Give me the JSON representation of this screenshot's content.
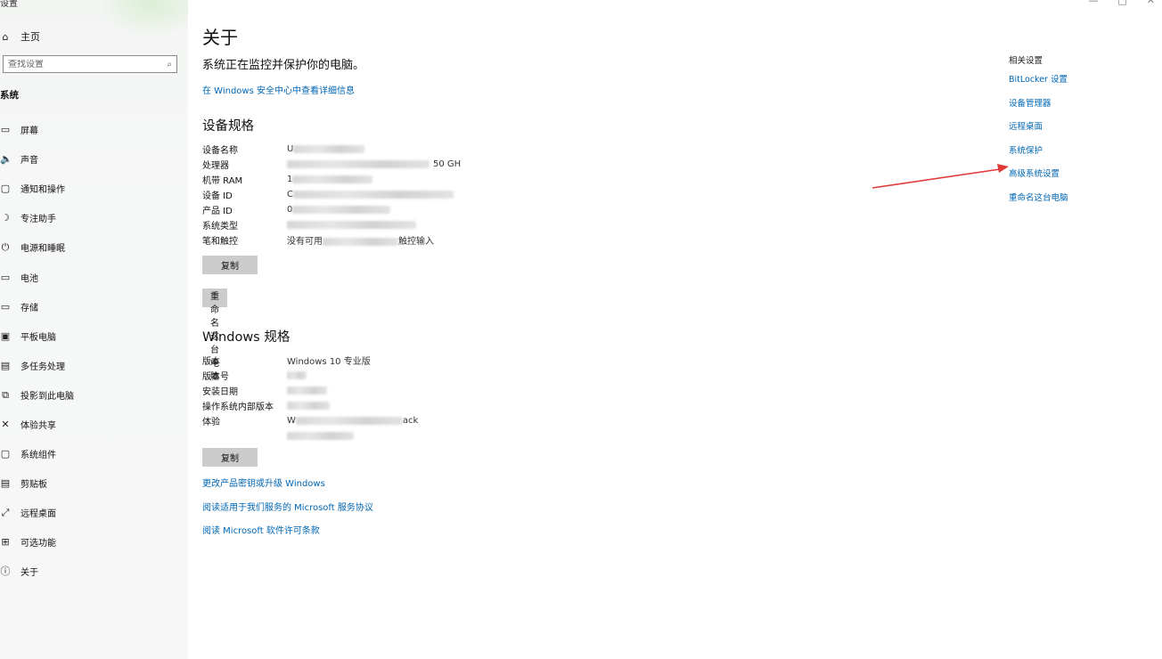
{
  "window": {
    "title": "设置",
    "controls": {
      "minimize": "—",
      "maximize": "□",
      "close": "✕"
    }
  },
  "sidebar": {
    "home_label": "主页",
    "search_placeholder": "查找设置",
    "section_label": "系统",
    "items": [
      {
        "label": "屏幕",
        "icon": "display-icon",
        "glyph": "▭"
      },
      {
        "label": "声音",
        "icon": "speaker-icon",
        "glyph": "🔈"
      },
      {
        "label": "通知和操作",
        "icon": "notification-icon",
        "glyph": "▢"
      },
      {
        "label": "专注助手",
        "icon": "moon-icon",
        "glyph": "☽"
      },
      {
        "label": "电源和睡眠",
        "icon": "power-icon",
        "glyph": "⏻"
      },
      {
        "label": "电池",
        "icon": "battery-icon",
        "glyph": "▭"
      },
      {
        "label": "存储",
        "icon": "storage-icon",
        "glyph": "▭"
      },
      {
        "label": "平板电脑",
        "icon": "tablet-icon",
        "glyph": "▣"
      },
      {
        "label": "多任务处理",
        "icon": "multitask-icon",
        "glyph": "▤"
      },
      {
        "label": "投影到此电脑",
        "icon": "project-icon",
        "glyph": "⧉"
      },
      {
        "label": "体验共享",
        "icon": "share-icon",
        "glyph": "✕"
      },
      {
        "label": "系统组件",
        "icon": "components-icon",
        "glyph": "▢"
      },
      {
        "label": "剪贴板",
        "icon": "clipboard-icon",
        "glyph": "▤"
      },
      {
        "label": "远程桌面",
        "icon": "remote-icon",
        "glyph": "⤢"
      },
      {
        "label": "可选功能",
        "icon": "features-icon",
        "glyph": "⊞"
      },
      {
        "label": "关于",
        "icon": "info-icon",
        "glyph": "ⓘ"
      }
    ]
  },
  "main": {
    "title": "关于",
    "subtitle": "系统正在监控并保护你的电脑。",
    "security_link": "在 Windows 安全中心中查看详细信息",
    "device_specs": {
      "heading": "设备规格",
      "rows": [
        {
          "key": "设备名称",
          "visible": "U",
          "blur_w": 80
        },
        {
          "key": "处理器",
          "visible": "50 GH",
          "blur_w": 160,
          "suffix": true
        },
        {
          "key": "机带 RAM",
          "visible": "1",
          "blur_w": 90
        },
        {
          "key": "设备 ID",
          "visible": "C",
          "blur_w": 180
        },
        {
          "key": "产品 ID",
          "visible": "0",
          "blur_w": 110
        },
        {
          "key": "系统类型",
          "visible": "",
          "blur_w": 145
        },
        {
          "key": "笔和触控",
          "visible": "没有可用",
          "tail": "触控输入",
          "blur_w": 85
        }
      ],
      "copy_button": "复制",
      "rename_button": "重命名这台电脑"
    },
    "windows_specs": {
      "heading": "Windows 规格",
      "rows": [
        {
          "key": "版本",
          "visible": "Windows 10 专业版",
          "blur_w": 0
        },
        {
          "key": "版本号",
          "visible": "",
          "blur_w": 22
        },
        {
          "key": "安装日期",
          "visible": "",
          "blur_w": 45
        },
        {
          "key": "操作系统内部版本",
          "visible": "",
          "blur_w": 48
        },
        {
          "key": "体验",
          "visible": "W",
          "tail": "ack",
          "blur_w": 120
        }
      ],
      "copy_button": "复制"
    },
    "links": [
      "更改产品密钥或升级 Windows",
      "阅读适用于我们服务的 Microsoft 服务协议",
      "阅读 Microsoft 软件许可条款"
    ]
  },
  "related": {
    "title": "相关设置",
    "links": [
      "BitLocker 设置",
      "设备管理器",
      "远程桌面",
      "系统保护",
      "高级系统设置",
      "重命名这台电脑"
    ]
  },
  "annotation": {
    "color": "#e03a3a"
  }
}
